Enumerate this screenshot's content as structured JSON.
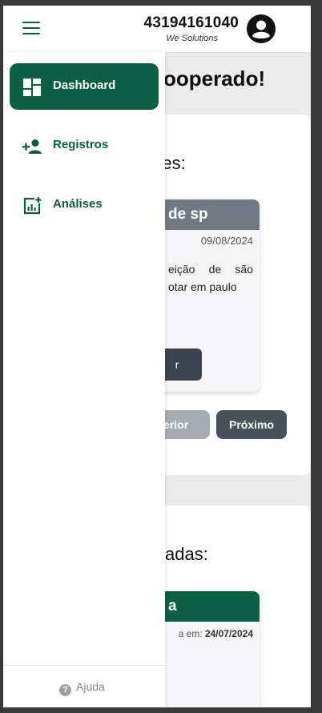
{
  "header": {
    "user_id": "43194161040",
    "company": "We Solutions"
  },
  "main": {
    "title_partial": "ooperado!",
    "section1_heading_partial": "ntes:",
    "event_card": {
      "title_partial": "de sp",
      "date": "09/08/2024",
      "text_partial": "eição de são otar em paulo",
      "action_partial": "r"
    },
    "pager": {
      "prev_partial": "nterior",
      "next": "Próximo"
    },
    "section2_heading_partial": "adas:",
    "event_card2": {
      "title_partial": "a",
      "date_prefix_partial": "a em:",
      "date": "24/07/2024"
    }
  },
  "sidebar": {
    "items": [
      {
        "label": "Dashboard",
        "icon": "dashboard-icon",
        "active": true
      },
      {
        "label": "Registros",
        "icon": "person-add-icon",
        "active": false
      },
      {
        "label": "Análises",
        "icon": "analytics-icon",
        "active": false
      }
    ],
    "help_label": "Ajuda"
  },
  "colors": {
    "brand_green": "#0b5f45",
    "card_header_grey": "#727985",
    "dark_button": "#4b515c"
  }
}
